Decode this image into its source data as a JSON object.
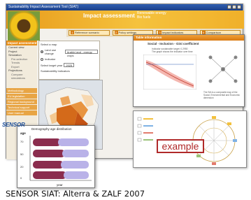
{
  "caption": "SENSOR SIAT: Alterra & ZALF 2007",
  "main_window": {
    "title": "Sustainability Impact Assessment Tool (SIAT)",
    "banner_title": "Impact assessment",
    "banner_sub_1": "Renewable energy",
    "banner_sub_2": "Bio fuels",
    "steps": [
      {
        "num": "1",
        "label": "Reference scenario"
      },
      {
        "num": "2",
        "label": "Policy settings"
      },
      {
        "num": "3",
        "label": "Impact indicators"
      },
      {
        "num": "4",
        "label": "Comparison"
      }
    ]
  },
  "sidebar": {
    "header": "Impact assessment",
    "items": [
      "Current view",
      "Project",
      "Simulation",
      "Pre-selection",
      "Trends",
      "Export"
    ],
    "sub_items": [
      "Projections",
      "Compare simulations"
    ],
    "blocks": [
      "Methodology",
      "EU legislation",
      "Regional background",
      "Technical support",
      "User manual"
    ]
  },
  "panel": {
    "title": "Select a map",
    "option_1": "Land use change",
    "option_1_select": "Arable land - energy crops",
    "option_2": "Indicator",
    "year_label": "Select target year",
    "year_value": "2025",
    "sustainability_label": "Sustainability indicators"
  },
  "right_window": {
    "title": "Table information",
    "chart_title": "Social - Inclusion - Gini coefficient",
    "info_line_1": "Indicator sustainable target: 0.2950",
    "info_line_2": "The graph shows the indicator over time",
    "note": "The SIA is a composite map of the Social, Environmental and Economic dimension"
  },
  "bottom_right_window": {
    "stamp": "example"
  },
  "demography_window": {
    "logo": "SENSOR",
    "title": "Demography age distribution",
    "ylabel": "age",
    "xlabel": "year",
    "ticks": [
      "70",
      "50",
      "20",
      "0"
    ]
  },
  "colors": {
    "banner_orange": "#f0a02a",
    "title_blue": "#1c3f85",
    "stamp_red": "#b02a2a",
    "bar_maroon": "#8b2d4e",
    "bar_lavender": "#b9b2e8"
  }
}
